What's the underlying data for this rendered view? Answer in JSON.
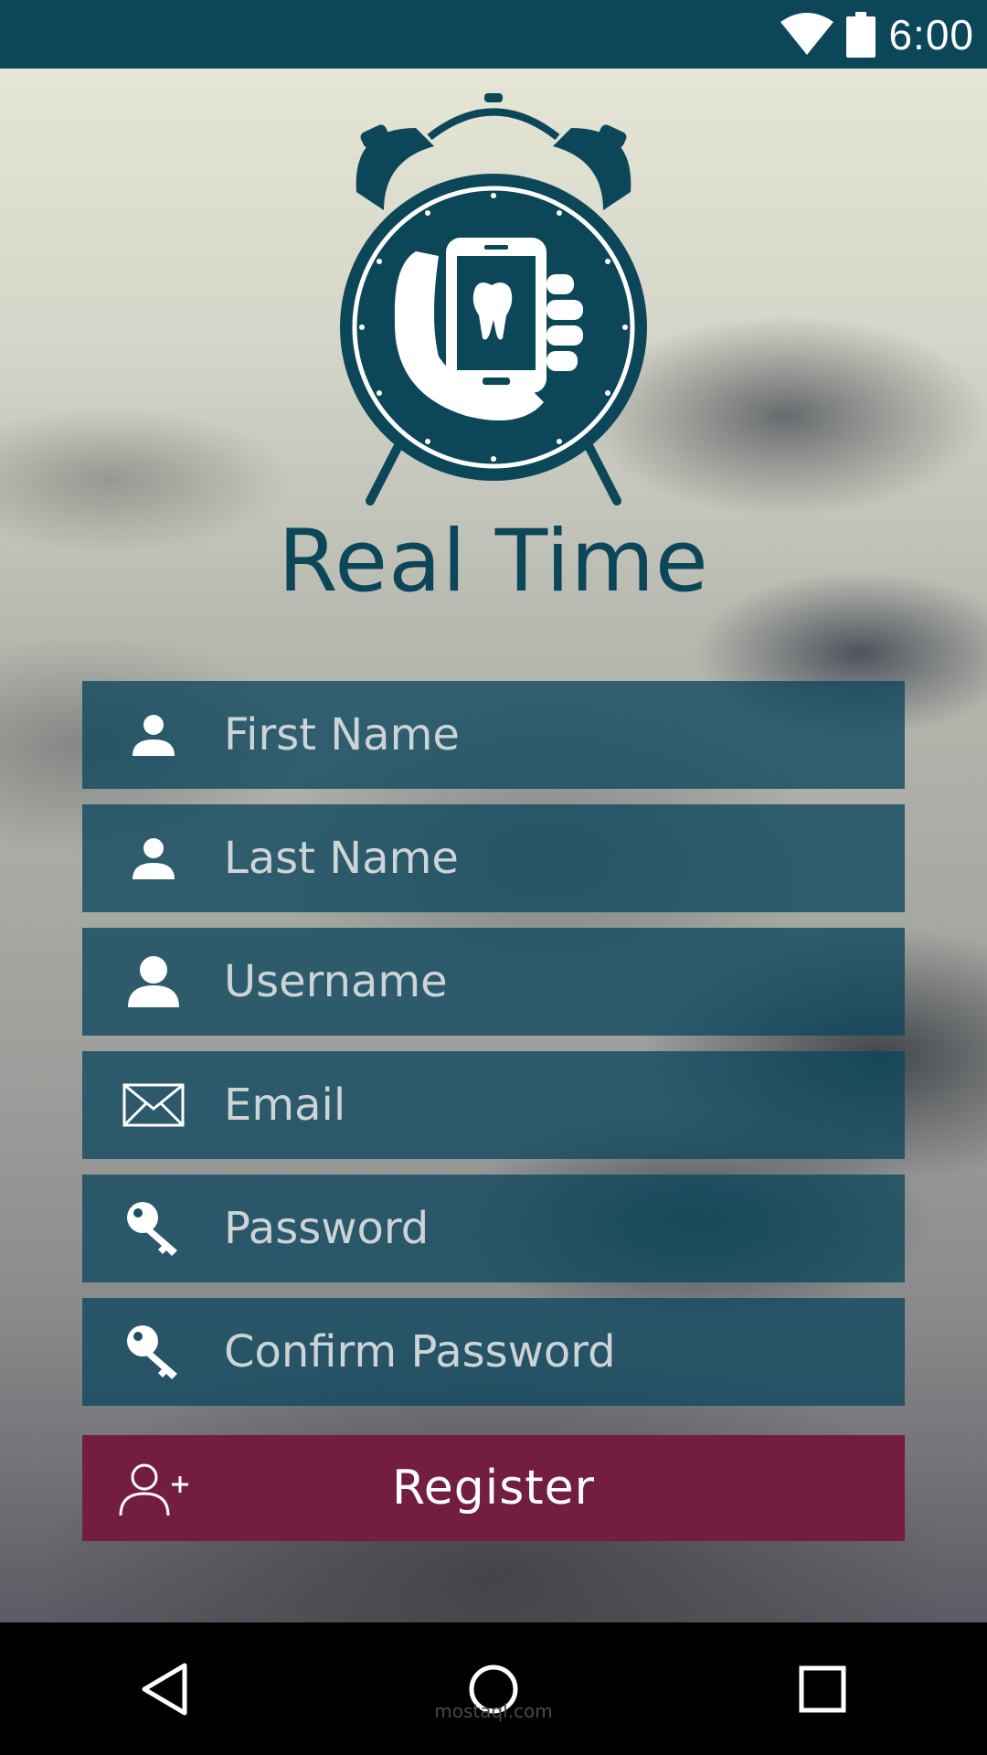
{
  "status_bar": {
    "time": "6:00",
    "icons": [
      "wifi-icon",
      "battery-icon"
    ]
  },
  "app": {
    "title": "Real Time"
  },
  "form": {
    "first_name": {
      "placeholder": "First Name",
      "icon": "person-icon"
    },
    "last_name": {
      "placeholder": "Last Name",
      "icon": "person-icon"
    },
    "username": {
      "placeholder": "Username",
      "icon": "person-icon"
    },
    "email": {
      "placeholder": "Email",
      "icon": "envelope-icon"
    },
    "password": {
      "placeholder": "Password",
      "icon": "key-icon"
    },
    "confirm_password": {
      "placeholder": "Confirm Password",
      "icon": "key-icon"
    }
  },
  "register": {
    "label": "Register",
    "icon": "add-user-icon"
  },
  "nav": {
    "buttons": [
      "back-icon",
      "home-icon",
      "recents-icon"
    ]
  },
  "watermark": {
    "text": "mostaql.com"
  },
  "colors": {
    "primary": "#0c4659",
    "field_bg": "#0d465d",
    "register_bg": "#731e40",
    "field_text": "#cdd4d6"
  }
}
